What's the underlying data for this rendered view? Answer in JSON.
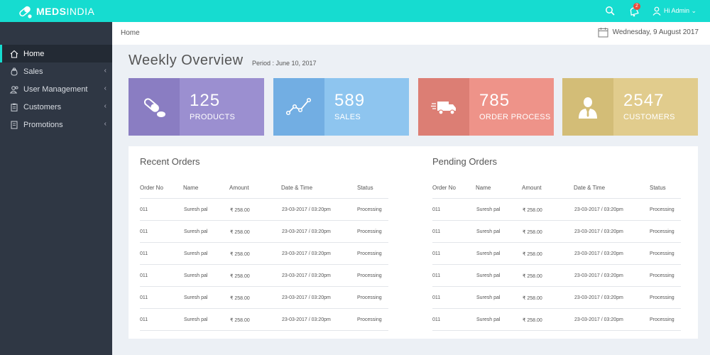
{
  "app": {
    "brand_bold": "MEDS",
    "brand_light": "INDIA"
  },
  "topbar": {
    "notification_count": "2",
    "user_label": "Hi Admin"
  },
  "sidebar": {
    "items": [
      {
        "label": "Home",
        "icon": "home-icon",
        "active": true
      },
      {
        "label": "Sales",
        "icon": "money-bag-icon"
      },
      {
        "label": "User Management",
        "icon": "users-icon"
      },
      {
        "label": "Customers",
        "icon": "clipboard-icon"
      },
      {
        "label": "Promotions",
        "icon": "tag-icon"
      }
    ],
    "chevron": "‹"
  },
  "breadcrumb": {
    "current": "Home",
    "date": "Wednesday, 9 August 2017"
  },
  "overview": {
    "title": "Weekly Overview",
    "period": "Period : June 10, 2017"
  },
  "cards": [
    {
      "value": "125",
      "label": "PRODUCTS",
      "icon": "pills-icon",
      "color": "#9b8fd0",
      "icon_bg": "#8a7dc2"
    },
    {
      "value": "589",
      "label": "SALES",
      "icon": "line-chart-icon",
      "color": "#8ec5ef",
      "icon_bg": "#72aee3"
    },
    {
      "value": "785",
      "label": "ORDER PROCESS",
      "icon": "delivery-truck-icon",
      "color": "#ee9389",
      "icon_bg": "#dc7e74"
    },
    {
      "value": "2547",
      "label": "CUSTOMERS",
      "icon": "customer-icon",
      "color": "#e1cc8d",
      "icon_bg": "#d3bd77"
    }
  ],
  "recent_orders": {
    "title": "Recent Orders",
    "headers": [
      "Order No",
      "Name",
      "Amount",
      "Date & Time",
      "Status"
    ],
    "rows": [
      [
        "011",
        "Suresh pal",
        "₹ 258.00",
        "23-03-2017 / 03:20pm",
        "Processing"
      ],
      [
        "011",
        "Suresh pal",
        "₹ 258.00",
        "23-03-2017 / 03:20pm",
        "Processing"
      ],
      [
        "011",
        "Suresh pal",
        "₹ 258.00",
        "23-03-2017 / 03:20pm",
        "Processing"
      ],
      [
        "011",
        "Suresh pal",
        "₹ 258.00",
        "23-03-2017 / 03:20pm",
        "Processing"
      ],
      [
        "011",
        "Suresh pal",
        "₹ 258.00",
        "23-03-2017 / 03:20pm",
        "Processing"
      ],
      [
        "011",
        "Suresh pal",
        "₹ 258.00",
        "23-03-2017 / 03:20pm",
        "Processing"
      ]
    ]
  },
  "pending_orders": {
    "title": "Pending Orders",
    "headers": [
      "Order No",
      "Name",
      "Amount",
      "Date & Time",
      "Status"
    ],
    "rows": [
      [
        "011",
        "Suresh pal",
        "₹ 258.00",
        "23-03-2017 / 03:20pm",
        "Processing"
      ],
      [
        "011",
        "Suresh pal",
        "₹ 258.00",
        "23-03-2017 / 03:20pm",
        "Processing"
      ],
      [
        "011",
        "Suresh pal",
        "₹ 258.00",
        "23-03-2017 / 03:20pm",
        "Processing"
      ],
      [
        "011",
        "Suresh pal",
        "₹ 258.00",
        "23-03-2017 / 03:20pm",
        "Processing"
      ],
      [
        "011",
        "Suresh pal",
        "₹ 258.00",
        "23-03-2017 / 03:20pm",
        "Processing"
      ],
      [
        "011",
        "Suresh pal",
        "₹ 258.00",
        "23-03-2017 / 03:20pm",
        "Processing"
      ]
    ]
  },
  "colors": {
    "accent": "#16dcd0",
    "sidebar": "#2f3744",
    "sidebar_active": "#232a34",
    "page_bg": "#ecf0f5"
  }
}
